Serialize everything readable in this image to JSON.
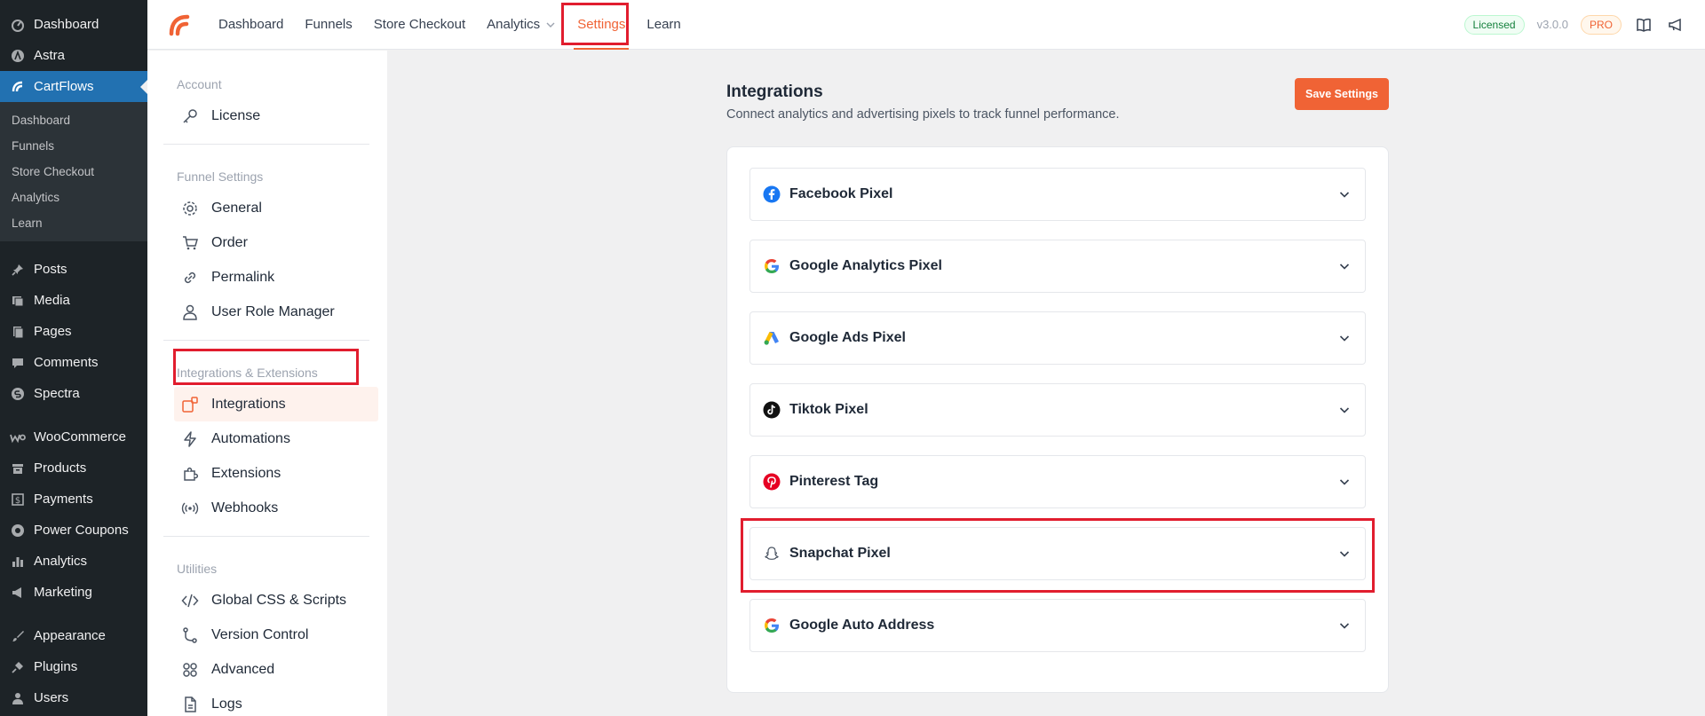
{
  "wp_menu": {
    "top": [
      {
        "label": "Dashboard",
        "icon": "dashboard-icon"
      },
      {
        "label": "Astra",
        "icon": "astra-icon"
      },
      {
        "label": "CartFlows",
        "icon": "cartflows-icon"
      }
    ],
    "sub": [
      "Dashboard",
      "Funnels",
      "Store Checkout",
      "Analytics",
      "Learn"
    ],
    "group1": [
      {
        "label": "Posts",
        "icon": "pin-icon"
      },
      {
        "label": "Media",
        "icon": "media-icon"
      },
      {
        "label": "Pages",
        "icon": "pages-icon"
      },
      {
        "label": "Comments",
        "icon": "comment-icon"
      },
      {
        "label": "Spectra",
        "icon": "spectra-icon"
      }
    ],
    "group2": [
      {
        "label": "WooCommerce",
        "icon": "woo-icon"
      },
      {
        "label": "Products",
        "icon": "archive-icon"
      },
      {
        "label": "Payments",
        "icon": "dollar-icon"
      },
      {
        "label": "Power Coupons",
        "icon": "coupon-icon"
      },
      {
        "label": "Analytics",
        "icon": "bar-chart-icon"
      },
      {
        "label": "Marketing",
        "icon": "megaphone-icon"
      }
    ],
    "group3": [
      {
        "label": "Appearance",
        "icon": "brush-icon"
      },
      {
        "label": "Plugins",
        "icon": "plug-icon"
      },
      {
        "label": "Users",
        "icon": "user-icon"
      }
    ]
  },
  "header": {
    "nav": [
      "Dashboard",
      "Funnels",
      "Store Checkout",
      "Analytics",
      "Settings",
      "Learn"
    ],
    "licensed": "Licensed",
    "version": "v3.0.0",
    "pro": "PRO"
  },
  "settings_nav": {
    "account_title": "Account",
    "account": [
      "License"
    ],
    "funnel_title": "Funnel Settings",
    "funnel": [
      "General",
      "Order",
      "Permalink",
      "User Role Manager"
    ],
    "integrations_title": "Integrations & Extensions",
    "integrations": [
      "Integrations",
      "Automations",
      "Extensions",
      "Webhooks"
    ],
    "utilities_title": "Utilities",
    "utilities": [
      "Global CSS & Scripts",
      "Version Control",
      "Advanced",
      "Logs"
    ]
  },
  "main": {
    "title": "Integrations",
    "subtitle": "Connect analytics and advertising pixels to track funnel performance.",
    "save_label": "Save Settings",
    "items": [
      {
        "label": "Facebook Pixel",
        "icon": "facebook-icon"
      },
      {
        "label": "Google Analytics Pixel",
        "icon": "google-icon"
      },
      {
        "label": "Google Ads Pixel",
        "icon": "google-ads-icon"
      },
      {
        "label": "Tiktok Pixel",
        "icon": "tiktok-icon"
      },
      {
        "label": "Pinterest Tag",
        "icon": "pinterest-icon"
      },
      {
        "label": "Snapchat Pixel",
        "icon": "snapchat-icon"
      },
      {
        "label": "Google Auto Address",
        "icon": "google-icon"
      }
    ]
  },
  "colors": {
    "accent": "#f06335",
    "wp_sidebar": "#1d2327",
    "wp_active": "#2271b1",
    "highlight_box": "#e11d2e"
  }
}
